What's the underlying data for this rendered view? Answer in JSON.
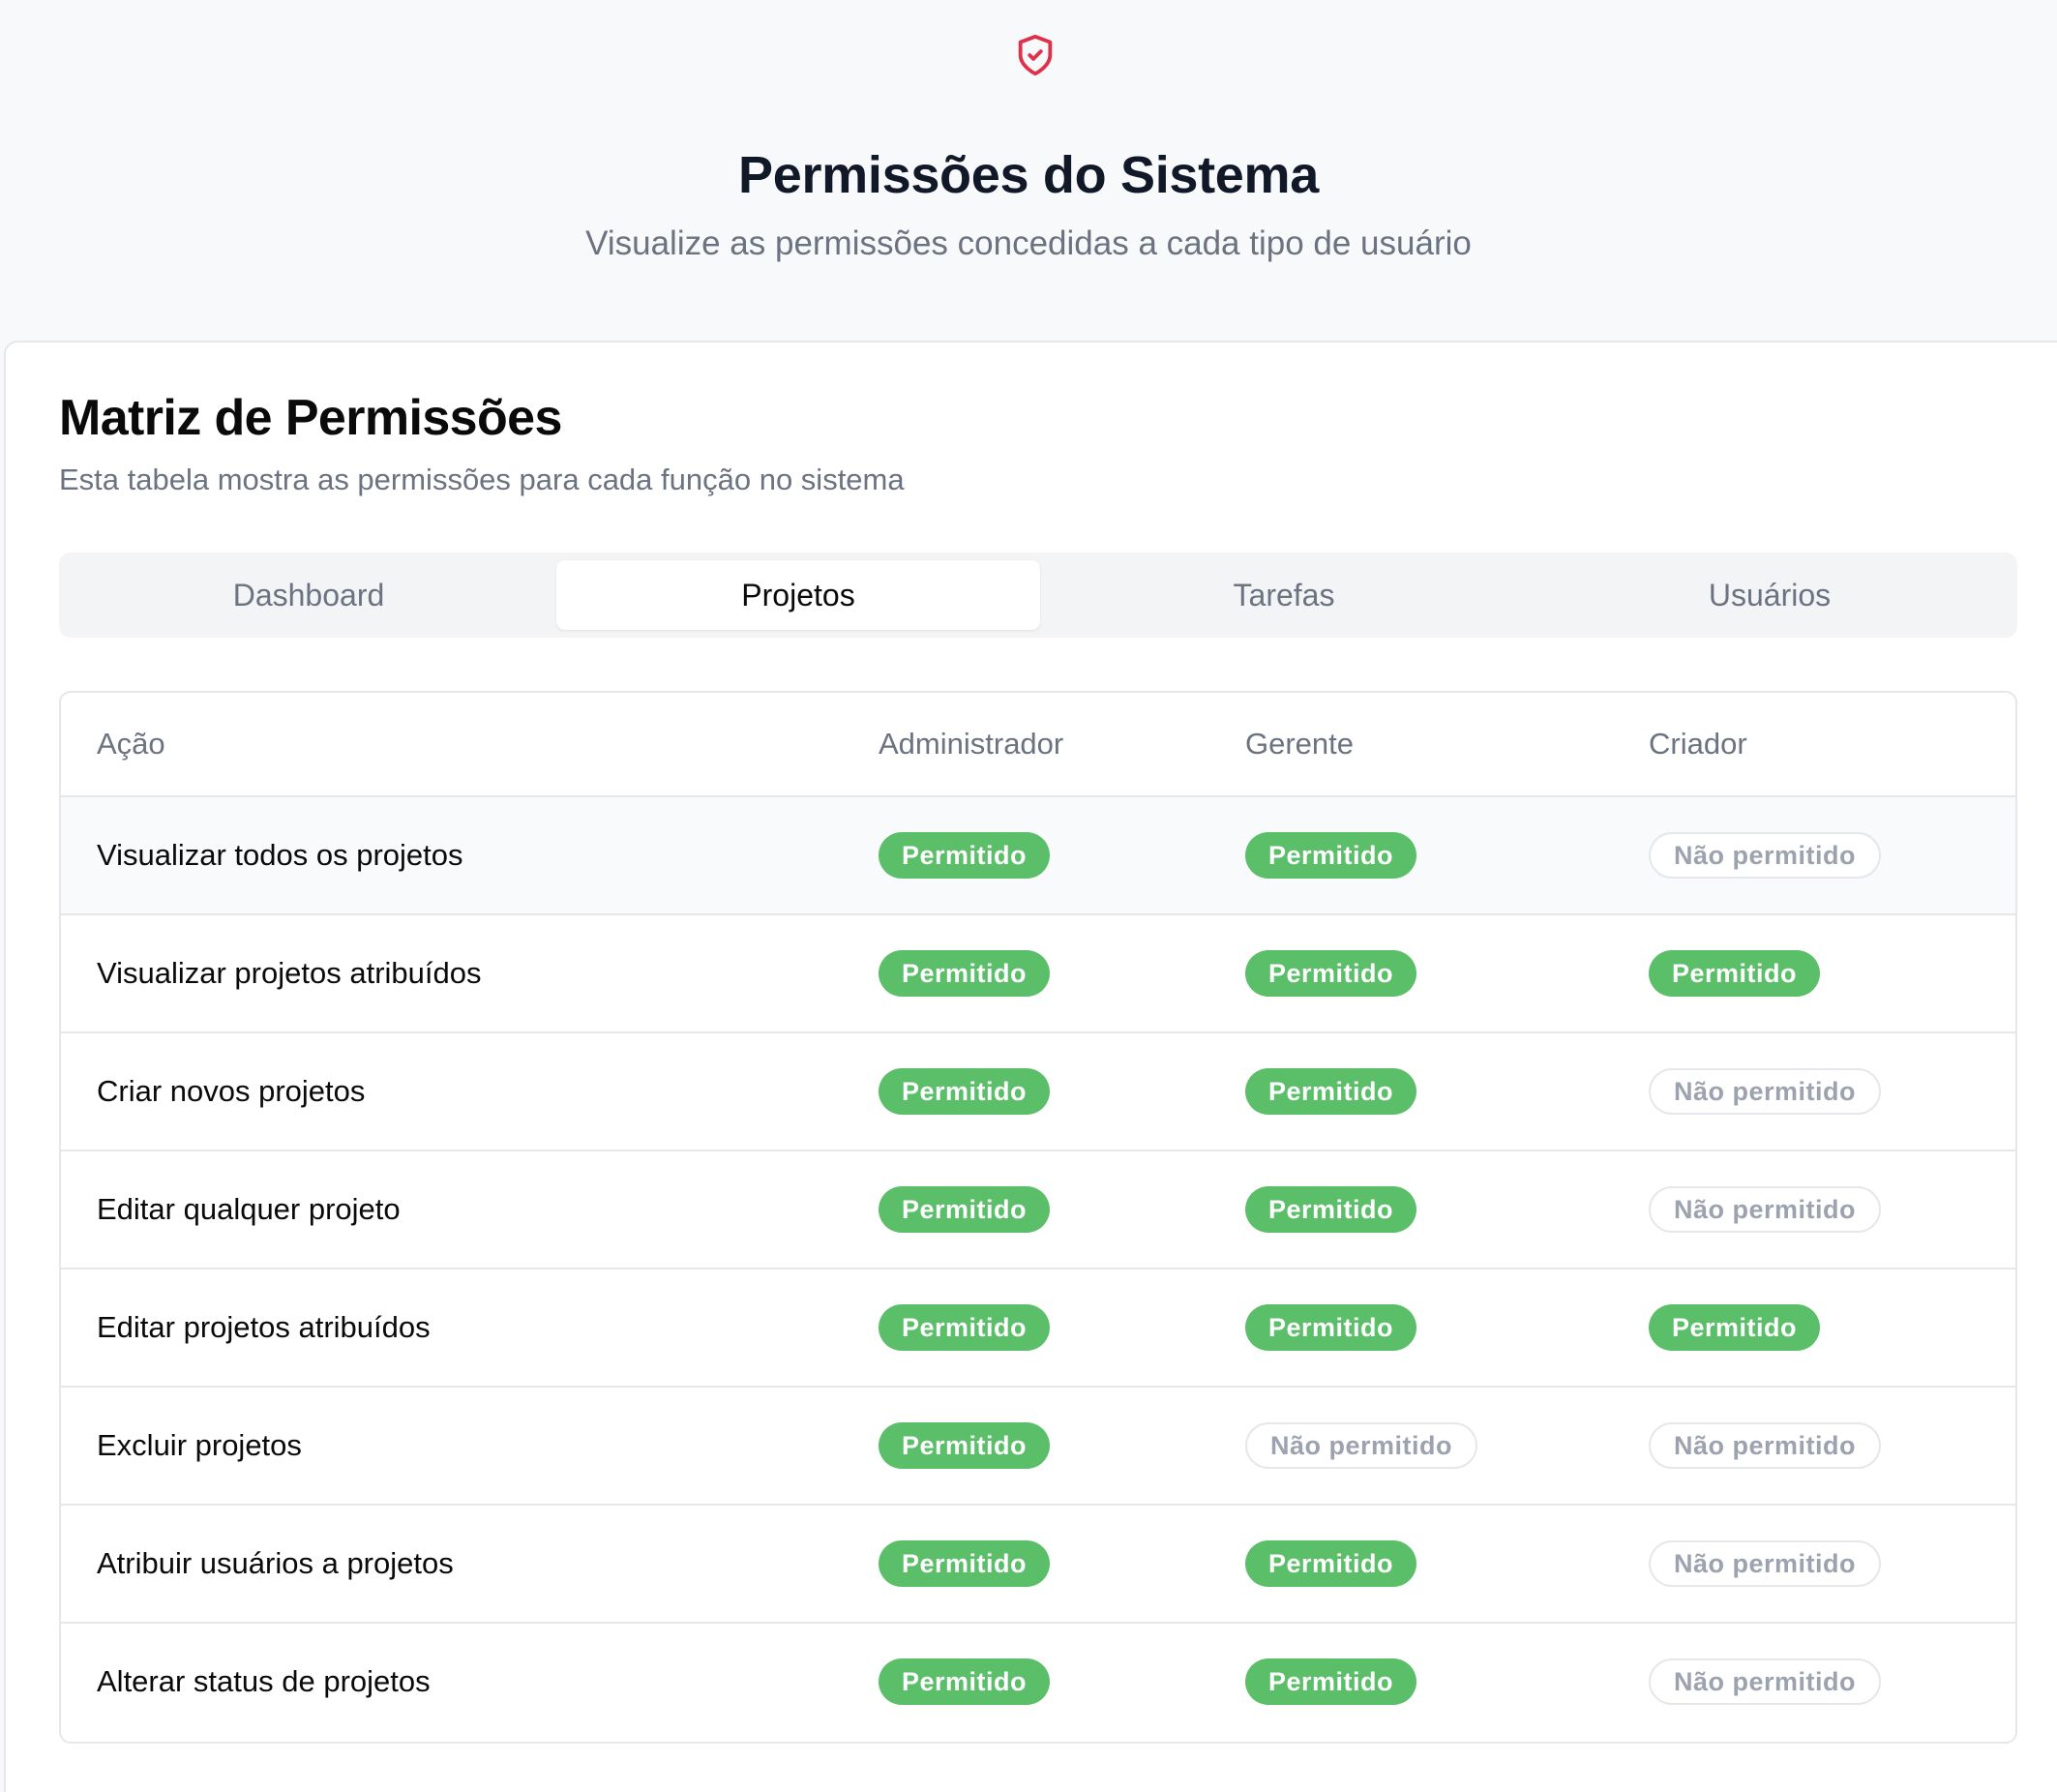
{
  "header": {
    "icon": "shield-check-icon",
    "icon_color": "#e0314b",
    "title": "Permissões do Sistema",
    "subtitle": "Visualize as permissões concedidas a cada tipo de usuário"
  },
  "card": {
    "title": "Matriz de Permissões",
    "subtitle": "Esta tabela mostra as permissões para cada função no sistema"
  },
  "tabs": [
    {
      "label": "Dashboard",
      "active": false
    },
    {
      "label": "Projetos",
      "active": true
    },
    {
      "label": "Tarefas",
      "active": false
    },
    {
      "label": "Usuários",
      "active": false
    }
  ],
  "table": {
    "columns": [
      "Ação",
      "Administrador",
      "Gerente",
      "Criador"
    ],
    "labels": {
      "allowed": "Permitido",
      "denied": "Não permitido"
    },
    "colors": {
      "allowed_bg": "#5bbf6a",
      "denied_border": "#e5e7eb"
    },
    "rows": [
      {
        "action": "Visualizar todos os projetos",
        "admin": "Permitido",
        "manager": "Permitido",
        "creator": "Não permitido"
      },
      {
        "action": "Visualizar projetos atribuídos",
        "admin": "Permitido",
        "manager": "Permitido",
        "creator": "Permitido"
      },
      {
        "action": "Criar novos projetos",
        "admin": "Permitido",
        "manager": "Permitido",
        "creator": "Não permitido"
      },
      {
        "action": "Editar qualquer projeto",
        "admin": "Permitido",
        "manager": "Permitido",
        "creator": "Não permitido"
      },
      {
        "action": "Editar projetos atribuídos",
        "admin": "Permitido",
        "manager": "Permitido",
        "creator": "Permitido"
      },
      {
        "action": "Excluir projetos",
        "admin": "Permitido",
        "manager": "Não permitido",
        "creator": "Não permitido"
      },
      {
        "action": "Atribuir usuários a projetos",
        "admin": "Permitido",
        "manager": "Permitido",
        "creator": "Não permitido"
      },
      {
        "action": "Alterar status de projetos",
        "admin": "Permitido",
        "manager": "Permitido",
        "creator": "Não permitido"
      }
    ]
  }
}
